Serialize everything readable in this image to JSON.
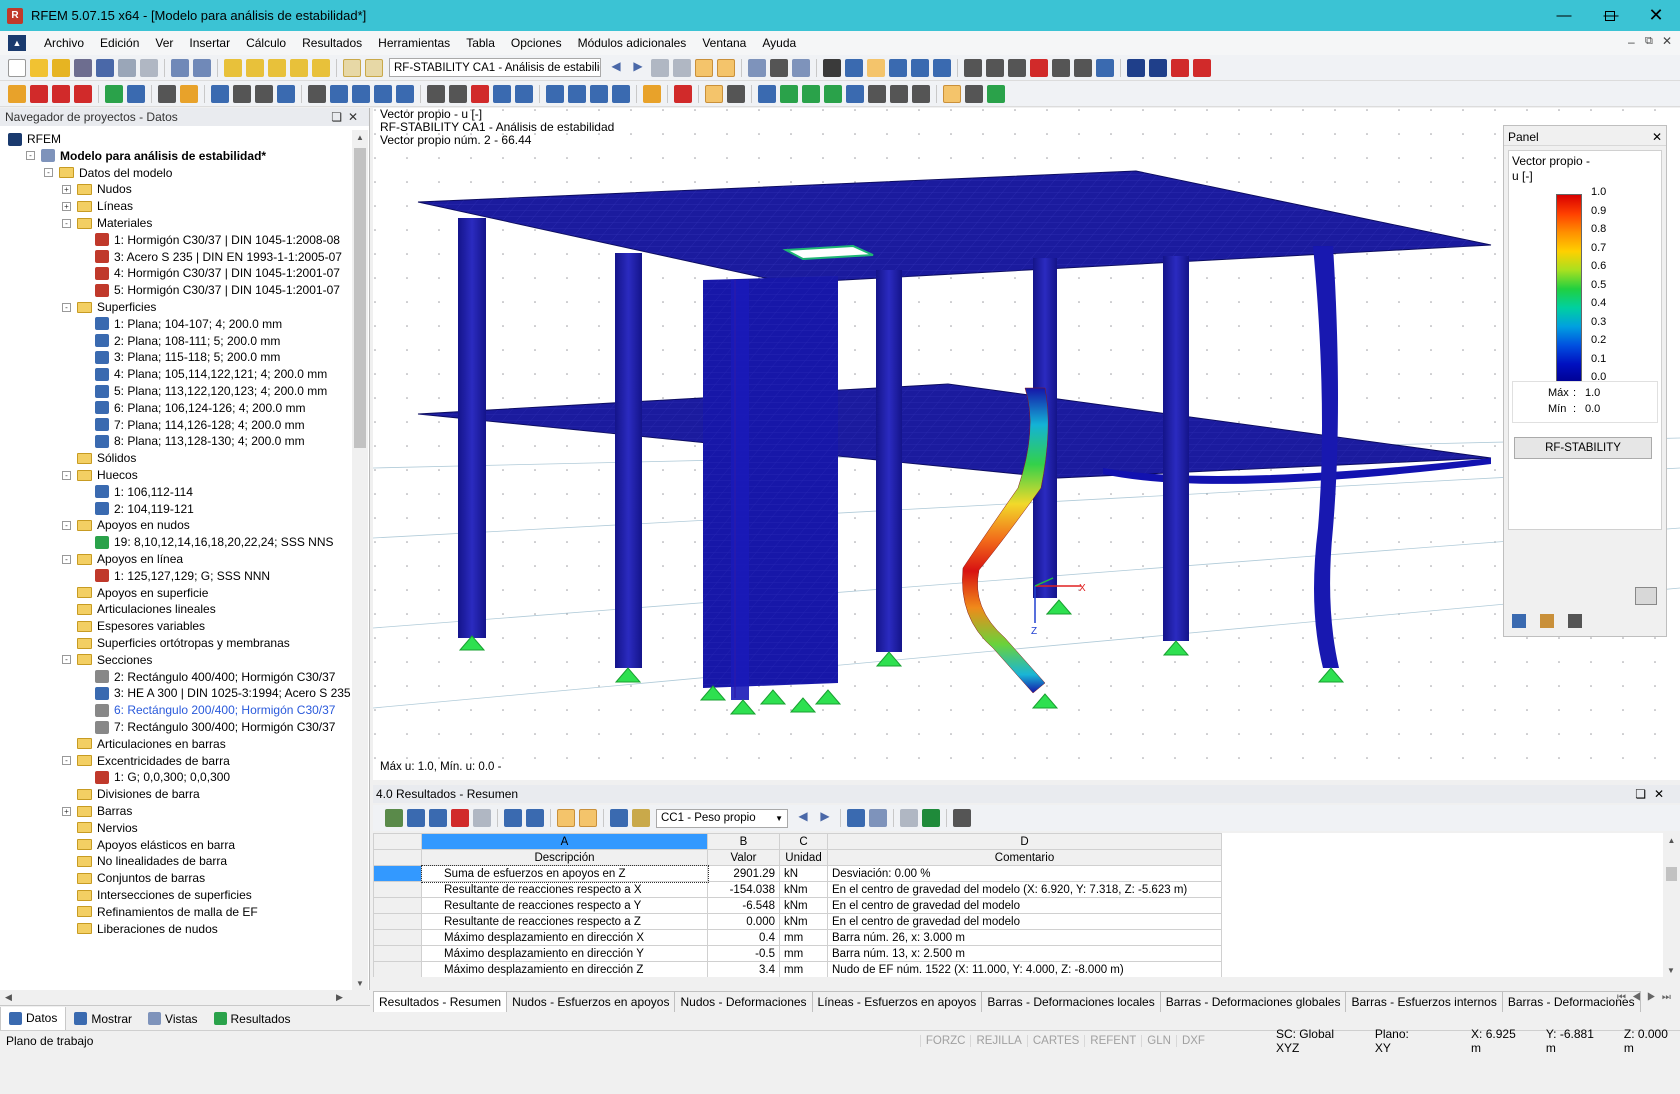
{
  "window": {
    "title": "RFEM 5.07.15 x64 - [Modelo para análisis de estabilidad*]"
  },
  "menu": [
    "Archivo",
    "Edición",
    "Ver",
    "Insertar",
    "Cálculo",
    "Resultados",
    "Herramientas",
    "Tabla",
    "Opciones",
    "Módulos adicionales",
    "Ventana",
    "Ayuda"
  ],
  "toolbar": {
    "loadcase_combo": "RF-STABILITY CA1 - Análisis de estabilid"
  },
  "navigator": {
    "title": "Navegador de proyectos - Datos",
    "tree": [
      {
        "label": "RFEM",
        "level": 0,
        "icon": "rfem-icon",
        "toggle": ""
      },
      {
        "label": "Modelo para análisis de estabilidad*",
        "level": 1,
        "icon": "model-icon",
        "toggle": "-",
        "bold": true
      },
      {
        "label": "Datos del modelo",
        "level": 2,
        "icon": "folder-icon",
        "toggle": "-"
      },
      {
        "label": "Nudos",
        "level": 3,
        "icon": "folder-icon",
        "toggle": "+"
      },
      {
        "label": "Líneas",
        "level": 3,
        "icon": "folder-icon",
        "toggle": "+"
      },
      {
        "label": "Materiales",
        "level": 3,
        "icon": "folder-icon",
        "toggle": "-"
      },
      {
        "label": "1: Hormigón C30/37 | DIN 1045-1:2008-08",
        "level": 4,
        "icon": "material-icon",
        "toggle": ""
      },
      {
        "label": "3: Acero S 235 | DIN EN 1993-1-1:2005-07",
        "level": 4,
        "icon": "material-icon",
        "toggle": ""
      },
      {
        "label": "4: Hormigón C30/37 | DIN 1045-1:2001-07",
        "level": 4,
        "icon": "material-icon",
        "toggle": ""
      },
      {
        "label": "5: Hormigón C30/37 | DIN 1045-1:2001-07",
        "level": 4,
        "icon": "material-icon",
        "toggle": ""
      },
      {
        "label": "Superficies",
        "level": 3,
        "icon": "folder-icon",
        "toggle": "-"
      },
      {
        "label": "1: Plana; 104-107; 4; 200.0 mm",
        "level": 4,
        "icon": "surface-icon",
        "toggle": ""
      },
      {
        "label": "2: Plana; 108-111; 5; 200.0 mm",
        "level": 4,
        "icon": "surface-icon",
        "toggle": ""
      },
      {
        "label": "3: Plana; 115-118; 5; 200.0 mm",
        "level": 4,
        "icon": "surface-icon",
        "toggle": ""
      },
      {
        "label": "4: Plana; 105,114,122,121; 4; 200.0 mm",
        "level": 4,
        "icon": "surface-icon",
        "toggle": ""
      },
      {
        "label": "5: Plana; 113,122,120,123; 4; 200.0 mm",
        "level": 4,
        "icon": "surface-icon",
        "toggle": ""
      },
      {
        "label": "6: Plana; 106,124-126; 4; 200.0 mm",
        "level": 4,
        "icon": "surface-icon",
        "toggle": ""
      },
      {
        "label": "7: Plana; 114,126-128; 4; 200.0 mm",
        "level": 4,
        "icon": "surface-icon",
        "toggle": ""
      },
      {
        "label": "8: Plana; 113,128-130; 4; 200.0 mm",
        "level": 4,
        "icon": "surface-icon",
        "toggle": ""
      },
      {
        "label": "Sólidos",
        "level": 3,
        "icon": "folder-icon",
        "toggle": ""
      },
      {
        "label": "Huecos",
        "level": 3,
        "icon": "folder-icon",
        "toggle": "-"
      },
      {
        "label": "1: 106,112-114",
        "level": 4,
        "icon": "opening-icon",
        "toggle": ""
      },
      {
        "label": "2: 104,119-121",
        "level": 4,
        "icon": "opening-icon",
        "toggle": ""
      },
      {
        "label": "Apoyos en nudos",
        "level": 3,
        "icon": "folder-icon",
        "toggle": "-"
      },
      {
        "label": "19: 8,10,12,14,16,18,20,22,24; SSS NNS",
        "level": 4,
        "icon": "support-icon",
        "toggle": ""
      },
      {
        "label": "Apoyos en línea",
        "level": 3,
        "icon": "folder-icon",
        "toggle": "-"
      },
      {
        "label": "1: 125,127,129; G; SSS NNN",
        "level": 4,
        "icon": "line-support-icon",
        "toggle": ""
      },
      {
        "label": "Apoyos en superficie",
        "level": 3,
        "icon": "folder-icon",
        "toggle": ""
      },
      {
        "label": "Articulaciones lineales",
        "level": 3,
        "icon": "folder-icon",
        "toggle": ""
      },
      {
        "label": "Espesores variables",
        "level": 3,
        "icon": "folder-icon",
        "toggle": ""
      },
      {
        "label": "Superficies ortótropas y membranas",
        "level": 3,
        "icon": "folder-icon",
        "toggle": ""
      },
      {
        "label": "Secciones",
        "level": 3,
        "icon": "folder-icon",
        "toggle": "-"
      },
      {
        "label": "2: Rectángulo 400/400; Hormigón C30/37",
        "level": 4,
        "icon": "section-rect-icon",
        "toggle": ""
      },
      {
        "label": "3: HE A 300 | DIN 1025-3:1994; Acero S 235",
        "level": 4,
        "icon": "section-i-icon",
        "toggle": ""
      },
      {
        "label": "6: Rectángulo 200/400; Hormigón C30/37",
        "level": 4,
        "icon": "section-rect-icon",
        "toggle": "",
        "highlight": true
      },
      {
        "label": "7: Rectángulo 300/400; Hormigón C30/37",
        "level": 4,
        "icon": "section-rect-icon",
        "toggle": ""
      },
      {
        "label": "Articulaciones en barras",
        "level": 3,
        "icon": "folder-icon",
        "toggle": ""
      },
      {
        "label": "Excentricidades de barra",
        "level": 3,
        "icon": "folder-icon",
        "toggle": "-"
      },
      {
        "label": "1: G; 0,0,300; 0,0,300",
        "level": 4,
        "icon": "eccentricity-icon",
        "toggle": ""
      },
      {
        "label": "Divisiones de barra",
        "level": 3,
        "icon": "folder-icon",
        "toggle": ""
      },
      {
        "label": "Barras",
        "level": 3,
        "icon": "folder-icon",
        "toggle": "+"
      },
      {
        "label": "Nervios",
        "level": 3,
        "icon": "folder-icon",
        "toggle": ""
      },
      {
        "label": "Apoyos elásticos en barra",
        "level": 3,
        "icon": "folder-icon",
        "toggle": ""
      },
      {
        "label": "No linealidades de barra",
        "level": 3,
        "icon": "folder-icon",
        "toggle": ""
      },
      {
        "label": "Conjuntos de barras",
        "level": 3,
        "icon": "folder-icon",
        "toggle": ""
      },
      {
        "label": "Intersecciones de superficies",
        "level": 3,
        "icon": "folder-icon",
        "toggle": ""
      },
      {
        "label": "Refinamientos de malla de EF",
        "level": 3,
        "icon": "folder-icon",
        "toggle": ""
      },
      {
        "label": "Liberaciones de nudos",
        "level": 3,
        "icon": "folder-icon",
        "toggle": ""
      }
    ],
    "tabs": [
      "Datos",
      "Mostrar",
      "Vistas",
      "Resultados"
    ]
  },
  "viewport": {
    "info1": "Vector propio - u [-]",
    "info2": "RF-STABILITY CA1 - Análisis de estabilidad",
    "info3": "Vector propio núm. 2  -  66.44",
    "footer": "Máx u: 1.0, Mín. u: 0.0 -",
    "axis_x": "X",
    "axis_z": "Z"
  },
  "panel": {
    "title": "Panel",
    "heading1": "Vector propio -",
    "heading2": "u [-]",
    "legend_values": [
      "1.0",
      "0.9",
      "0.8",
      "0.7",
      "0.6",
      "0.5",
      "0.4",
      "0.3",
      "0.2",
      "0.1",
      "0.0"
    ],
    "max_label": "Máx",
    "max_value": "1.0",
    "min_label": "Mín",
    "min_value": "0.0",
    "button": "RF-STABILITY"
  },
  "results": {
    "title": "4.0 Resultados - Resumen",
    "combo": "CC1 - Peso propio",
    "col_letters": [
      "A",
      "B",
      "C",
      "D"
    ],
    "col_headers": [
      "Descripción",
      "Valor",
      "Unidad",
      "Comentario"
    ],
    "rows": [
      {
        "desc": "Suma de esfuerzos en apoyos en Z",
        "value": "2901.29",
        "unit": "kN",
        "comment": "Desviación:  0.00 %"
      },
      {
        "desc": "Resultante de reacciones respecto a X",
        "value": "-154.038",
        "unit": "kNm",
        "comment": "En el centro de gravedad del modelo (X: 6.920, Y: 7.318, Z: -5.623 m)"
      },
      {
        "desc": "Resultante de reacciones respecto a Y",
        "value": "-6.548",
        "unit": "kNm",
        "comment": "En el centro de gravedad del modelo"
      },
      {
        "desc": "Resultante de reacciones respecto a Z",
        "value": "0.000",
        "unit": "kNm",
        "comment": "En el centro de gravedad del modelo"
      },
      {
        "desc": "Máximo desplazamiento en dirección X",
        "value": "0.4",
        "unit": "mm",
        "comment": "Barra núm. 26,  x: 3.000 m"
      },
      {
        "desc": "Máximo desplazamiento en dirección Y",
        "value": "-0.5",
        "unit": "mm",
        "comment": "Barra núm. 13,  x: 2.500 m"
      },
      {
        "desc": "Máximo desplazamiento en dirección Z",
        "value": "3.4",
        "unit": "mm",
        "comment": "Nudo de EF núm. 1522  (X: 11.000,  Y: 4.000,  Z: -8.000 m)"
      }
    ],
    "tabs": [
      "Resultados - Resumen",
      "Nudos - Esfuerzos en apoyos",
      "Nudos - Deformaciones",
      "Líneas - Esfuerzos en apoyos",
      "Barras - Deformaciones locales",
      "Barras - Deformaciones globales",
      "Barras - Esfuerzos internos",
      "Barras - Deformaciones"
    ]
  },
  "statusbar": {
    "left": "Plano de trabajo",
    "toggles": [
      "FORZC",
      "REJILLA",
      "CARTES",
      "REFENT",
      "GLN",
      "DXF"
    ],
    "cs": "SC: Global XYZ",
    "plane": "Plano: XY",
    "x": "X:  6.925 m",
    "y": "Y:  -6.881 m",
    "z": "Z:  0.000 m"
  },
  "colors": {
    "titlebar": "#3bc3d4",
    "slab": "#1a1aa0",
    "selection": "#3399ff"
  }
}
